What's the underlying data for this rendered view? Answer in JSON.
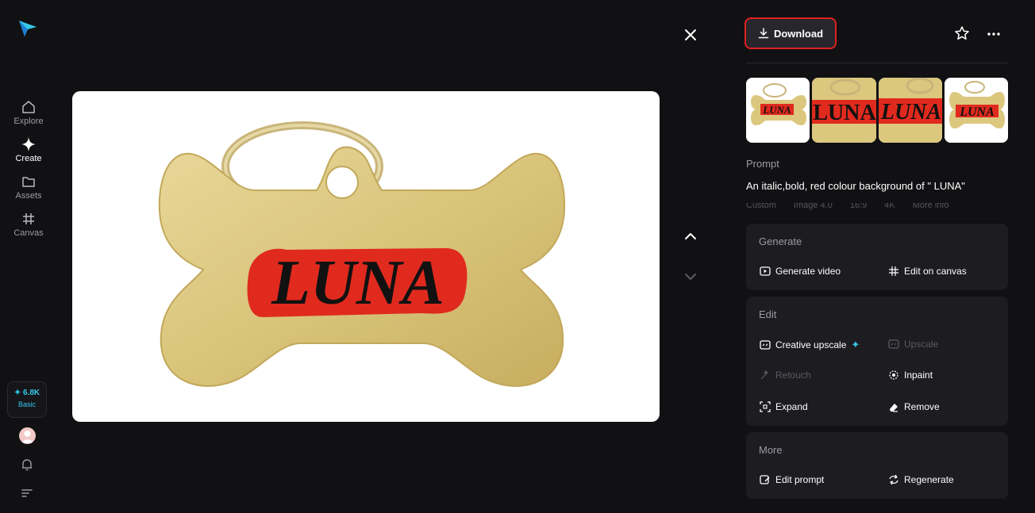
{
  "nav": {
    "items": [
      {
        "label": "Explore",
        "icon": "home-icon"
      },
      {
        "label": "Create",
        "icon": "sparkle-icon"
      },
      {
        "label": "Assets",
        "icon": "folder-icon"
      },
      {
        "label": "Canvas",
        "icon": "canvas-icon"
      }
    ],
    "active": "Create",
    "credits": "✦ 6.8K",
    "plan": "Basic"
  },
  "preview": {
    "image_text": "LUNA"
  },
  "toolbar": {
    "download_label": "Download"
  },
  "thumbnails": [
    {
      "text": "LUNA"
    },
    {
      "text": "LUNA"
    },
    {
      "text": "LUNA"
    },
    {
      "text": "LUNA",
      "selected": true
    }
  ],
  "prompt": {
    "label": "Prompt",
    "text": "An italic,bold, red colour background of \" LUNA\"",
    "meta": [
      "Custom",
      "Image 4.0",
      "16:9",
      "4K",
      "More info"
    ]
  },
  "sections": {
    "generate": {
      "title": "Generate",
      "generate_video": "Generate video",
      "edit_on_canvas": "Edit on canvas"
    },
    "edit": {
      "title": "Edit",
      "creative_upscale": "Creative upscale",
      "upscale": "Upscale",
      "retouch": "Retouch",
      "inpaint": "Inpaint",
      "expand": "Expand",
      "remove": "Remove"
    },
    "more": {
      "title": "More",
      "edit_prompt": "Edit prompt",
      "regenerate": "Regenerate"
    }
  },
  "colors": {
    "background": "#111114",
    "panel": "#1c1c21",
    "accent": "#35c8e8",
    "highlight_border": "#e02020"
  }
}
